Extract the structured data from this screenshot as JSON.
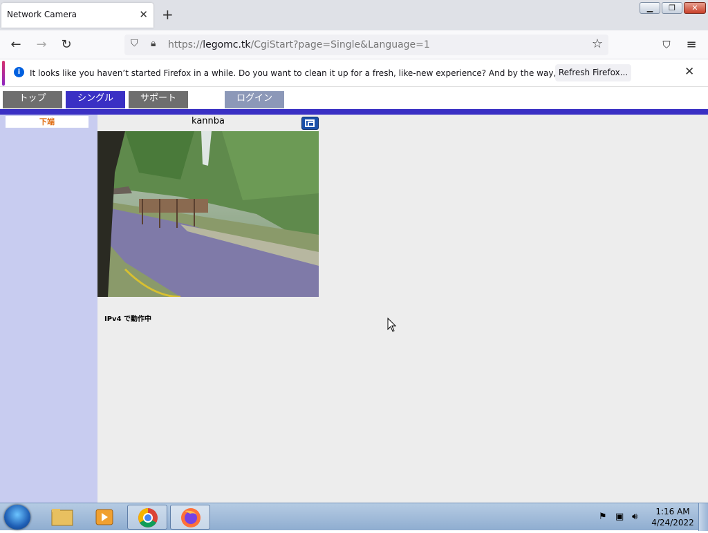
{
  "browser": {
    "tab_title": "Network Camera",
    "tab_close_icon": "close-icon",
    "new_tab_icon": "plus-icon",
    "url_host": "legomc.tk",
    "url_prefix": "https://",
    "url_path": "/CgiStart?page=Single&Language=1"
  },
  "notification": {
    "message": "It looks like you haven’t started Firefox in a while. Do you want to clean it up for a fresh, like-new experience? And by the way, welcome back!",
    "button_label": "Refresh Firefox..."
  },
  "camera_page": {
    "menu": {
      "top": "トップ",
      "single": "シングル",
      "support": "サポート",
      "login": "ログイン"
    },
    "sidebar_button": "下端",
    "camera_name": "kannba",
    "status": "IPv4 で動作中",
    "accent_color": "#3a30c4"
  },
  "taskbar": {
    "time": "1:16 AM",
    "date": "4/24/2022"
  }
}
